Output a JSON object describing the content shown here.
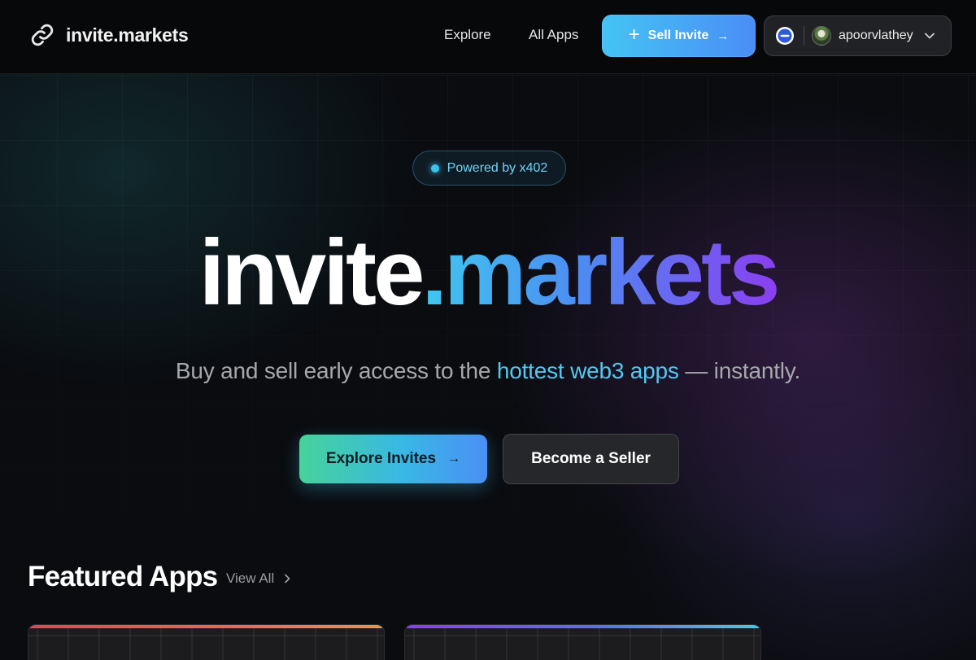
{
  "navbar": {
    "brand": "invite.markets",
    "links": [
      "Explore",
      "All Apps"
    ],
    "sell_button": "Sell Invite",
    "account": {
      "username": "apoorvlathey"
    }
  },
  "hero": {
    "badge": "Powered by x402",
    "title_part1": "invite",
    "title_part2": ".markets",
    "tagline_before": "Buy and sell early access to the ",
    "tagline_highlight": "hottest web3 apps",
    "tagline_after": " — instantly.",
    "cta_primary": "Explore Invites",
    "cta_secondary": "Become a Seller"
  },
  "featured": {
    "title": "Featured Apps",
    "view_all": "View All",
    "cards": [
      {
        "accent_from": "#e0475a",
        "accent_to": "#f0924a"
      },
      {
        "accent_from": "#8a40f0",
        "accent_to": "#49c7ea"
      }
    ]
  },
  "icons": {
    "brand": "link-chain-icon",
    "plus": "plus-icon",
    "arrow": "arrow-right-icon",
    "wallet": "wallet-network-icon",
    "chevron_down": "chevron-down-icon",
    "chevron_right": "chevron-right-icon"
  },
  "colors": {
    "accent_cyan": "#3ec9f0",
    "accent_blue": "#4d8bf2",
    "accent_purple": "#8a3ff0",
    "background": "#0a0c10"
  }
}
